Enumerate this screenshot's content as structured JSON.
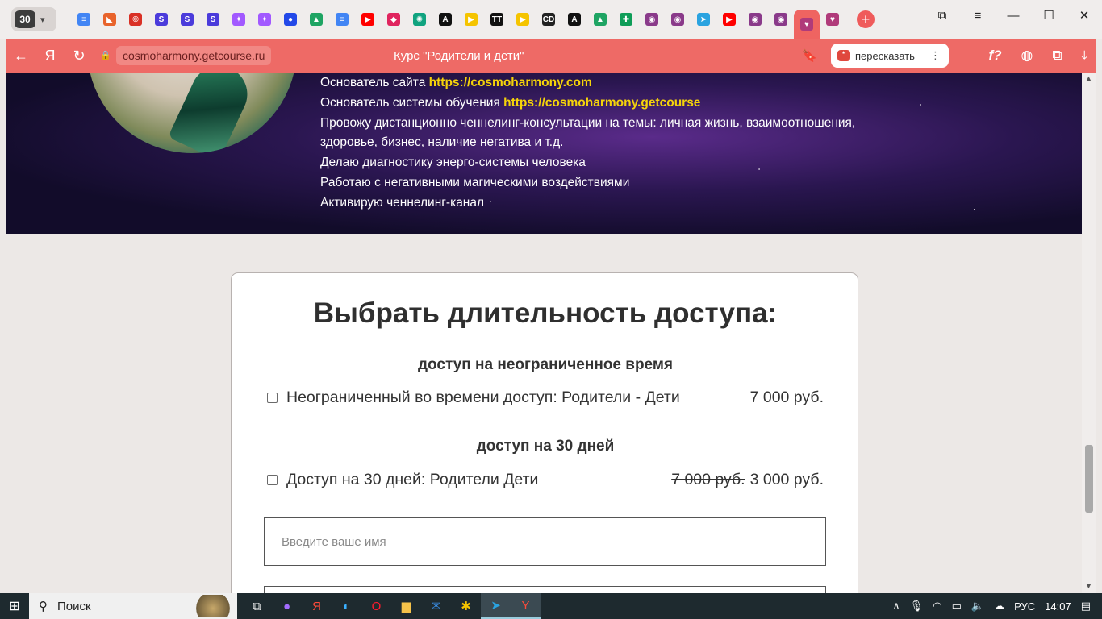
{
  "browser": {
    "tab_count": "30",
    "tabs": [
      {
        "icon": "docs-icon",
        "color": "#4285f4",
        "glyph": "≡"
      },
      {
        "icon": "ok-icon",
        "color": "#e8632b",
        "glyph": "◣"
      },
      {
        "icon": "copyright-icon",
        "color": "#d93025",
        "glyph": "©"
      },
      {
        "icon": "s-app-icon",
        "color": "#4b3bdb",
        "glyph": "S"
      },
      {
        "icon": "s-app-icon",
        "color": "#4b3bdb",
        "glyph": "S"
      },
      {
        "icon": "s-app-icon",
        "color": "#4b3bdb",
        "glyph": "S"
      },
      {
        "icon": "figma-icon",
        "color": "#a259ff",
        "glyph": "✦"
      },
      {
        "icon": "figma-icon",
        "color": "#a259ff",
        "glyph": "✦"
      },
      {
        "icon": "dot-icon",
        "color": "#2349e8",
        "glyph": "●"
      },
      {
        "icon": "drive-icon",
        "color": "#1fa463",
        "glyph": "▲"
      },
      {
        "icon": "docs-icon",
        "color": "#4285f4",
        "glyph": "≡"
      },
      {
        "icon": "youtube-icon",
        "color": "#ff0000",
        "glyph": "▶"
      },
      {
        "icon": "gem-icon",
        "color": "#e0245e",
        "glyph": "◆"
      },
      {
        "icon": "chatgpt-icon",
        "color": "#10a37f",
        "glyph": "✺"
      },
      {
        "icon": "a-icon",
        "color": "#111111",
        "glyph": "A"
      },
      {
        "icon": "play-icon",
        "color": "#f5c400",
        "glyph": "▶"
      },
      {
        "icon": "tt-icon",
        "color": "#111111",
        "glyph": "TT"
      },
      {
        "icon": "play-icon",
        "color": "#f5c400",
        "glyph": "▶"
      },
      {
        "icon": "cd-icon",
        "color": "#222222",
        "glyph": "CD"
      },
      {
        "icon": "a-icon",
        "color": "#111111",
        "glyph": "A"
      },
      {
        "icon": "drive-icon",
        "color": "#1fa463",
        "glyph": "▲"
      },
      {
        "icon": "sheets-icon",
        "color": "#0f9d58",
        "glyph": "✚"
      },
      {
        "icon": "cosmo-icon",
        "color": "#8a3a8a",
        "glyph": "◉"
      },
      {
        "icon": "cosmo-icon",
        "color": "#8a3a8a",
        "glyph": "◉"
      },
      {
        "icon": "telegram-icon",
        "color": "#2aa3e0",
        "glyph": "➤"
      },
      {
        "icon": "youtube-icon",
        "color": "#ff0000",
        "glyph": "▶"
      },
      {
        "icon": "cosmo-icon",
        "color": "#8a3a8a",
        "glyph": "◉"
      },
      {
        "icon": "cosmo-icon",
        "color": "#8a3a8a",
        "glyph": "◉"
      },
      {
        "icon": "getcourse-icon",
        "color": "#b03a7a",
        "glyph": "♥",
        "active": true
      },
      {
        "icon": "getcourse-icon",
        "color": "#b03a7a",
        "glyph": "♥"
      }
    ],
    "url": "cosmoharmony.getcourse.ru",
    "page_title": "Курс \"Родители и дети\"",
    "retell_label": "пересказать"
  },
  "bio": {
    "site_prefix": "Основатель сайта ",
    "site_link": "https://cosmoharmony.com",
    "system_prefix": "Основатель системы обучения ",
    "system_link": "https://cosmoharmony.getcourse",
    "line3": "Провожу дистанционно ченнелинг-консультации на темы: личная жизнь, взаимоотношения,",
    "line4": "здоровье, бизнес, наличие негатива и т.д.",
    "line5": "Делаю диагностику энерго-системы человека",
    "line6": "Работаю с негативными магическими воздействиями",
    "line7": "Активирую ченнелинг-канал"
  },
  "offer": {
    "heading": "Выбрать длительность доступа:",
    "group1_title": "доступ на неограниченное время",
    "option1_label": "Неограниченный во времени доступ: Родители - Дети",
    "option1_price": "7 000 руб.",
    "group2_title": "доступ на 30 дней",
    "option2_label": "Доступ на 30 дней: Родители Дети",
    "option2_old_price": "7 000 руб.",
    "option2_price": "3 000 руб.",
    "name_placeholder": "Введите ваше имя"
  },
  "taskbar": {
    "search_label": "Поиск",
    "language": "РУС",
    "time": "14:07"
  },
  "colors": {
    "accent": "#ef6461",
    "link_yellow": "#f5d30a"
  }
}
